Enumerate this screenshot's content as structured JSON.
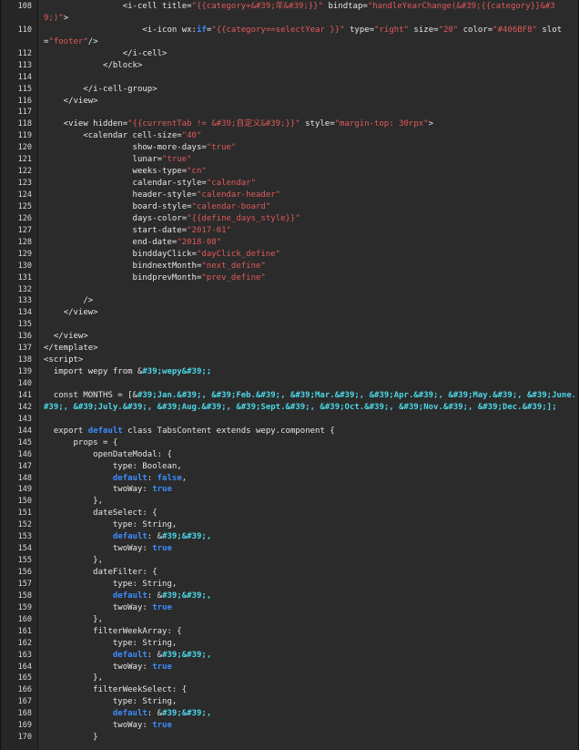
{
  "editor": {
    "colors": {
      "background": "#2b2b2b",
      "plain": "#e6e6e6",
      "string": "#e05a5a",
      "entity": "#4cd6e6",
      "keyword": "#3b8cff"
    },
    "lines": [
      {
        "num": "108",
        "tokens": [
          {
            "t": "p",
            "v": "                <i-cell title="
          },
          {
            "t": "s",
            "v": "\"{{category+&#39;年&#39;}}\""
          },
          {
            "t": "p",
            "v": " bindtap="
          },
          {
            "t": "s",
            "v": "\"handleYearChange(&#39;{{category}}&#3"
          }
        ]
      },
      {
        "num": "",
        "tokens": [
          {
            "t": "s",
            "v": "9;)\""
          },
          {
            "t": "p",
            "v": ">"
          }
        ]
      },
      {
        "num": "110",
        "tokens": [
          {
            "t": "p",
            "v": "                    <i-icon wx:"
          },
          {
            "t": "k",
            "v": "if"
          },
          {
            "t": "p",
            "v": "="
          },
          {
            "t": "s",
            "v": "\"{{category==selectYear }}\""
          },
          {
            "t": "p",
            "v": " type="
          },
          {
            "t": "s",
            "v": "\"right\""
          },
          {
            "t": "p",
            "v": " size="
          },
          {
            "t": "s",
            "v": "\"20\""
          },
          {
            "t": "p",
            "v": " color="
          },
          {
            "t": "s",
            "v": "\"#406BF8\""
          },
          {
            "t": "p",
            "v": " slot"
          }
        ]
      },
      {
        "num": "",
        "tokens": [
          {
            "t": "p",
            "v": "="
          },
          {
            "t": "s",
            "v": "\"footer\""
          },
          {
            "t": "p",
            "v": "/>"
          }
        ]
      },
      {
        "num": "112",
        "tokens": [
          {
            "t": "p",
            "v": "                </i-cell>"
          }
        ]
      },
      {
        "num": "113",
        "tokens": [
          {
            "t": "p",
            "v": "            </block>"
          }
        ]
      },
      {
        "num": "114",
        "tokens": [
          {
            "t": "p",
            "v": ""
          }
        ]
      },
      {
        "num": "115",
        "tokens": [
          {
            "t": "p",
            "v": "        </i-cell-group>"
          }
        ]
      },
      {
        "num": "116",
        "tokens": [
          {
            "t": "p",
            "v": "    </view>"
          }
        ]
      },
      {
        "num": "117",
        "tokens": [
          {
            "t": "p",
            "v": ""
          }
        ]
      },
      {
        "num": "118",
        "tokens": [
          {
            "t": "p",
            "v": "    <view hidden="
          },
          {
            "t": "s",
            "v": "\"{{currentTab != &#39;自定义&#39;}}\""
          },
          {
            "t": "p",
            "v": " style="
          },
          {
            "t": "s",
            "v": "\"margin-top: 30rpx\""
          },
          {
            "t": "p",
            "v": ">"
          }
        ]
      },
      {
        "num": "119",
        "tokens": [
          {
            "t": "p",
            "v": "        <calendar cell-size="
          },
          {
            "t": "s",
            "v": "\"40\""
          }
        ]
      },
      {
        "num": "120",
        "tokens": [
          {
            "t": "p",
            "v": "                  show-more-days="
          },
          {
            "t": "s",
            "v": "\"true\""
          }
        ]
      },
      {
        "num": "121",
        "tokens": [
          {
            "t": "p",
            "v": "                  lunar="
          },
          {
            "t": "s",
            "v": "\"true\""
          }
        ]
      },
      {
        "num": "122",
        "tokens": [
          {
            "t": "p",
            "v": "                  weeks-type="
          },
          {
            "t": "s",
            "v": "\"cn\""
          }
        ]
      },
      {
        "num": "123",
        "tokens": [
          {
            "t": "p",
            "v": "                  calendar-style="
          },
          {
            "t": "s",
            "v": "\"calendar\""
          }
        ]
      },
      {
        "num": "124",
        "tokens": [
          {
            "t": "p",
            "v": "                  header-style="
          },
          {
            "t": "s",
            "v": "\"calendar-header\""
          }
        ]
      },
      {
        "num": "125",
        "tokens": [
          {
            "t": "p",
            "v": "                  board-style="
          },
          {
            "t": "s",
            "v": "\"calendar-board\""
          }
        ]
      },
      {
        "num": "126",
        "tokens": [
          {
            "t": "p",
            "v": "                  days-color="
          },
          {
            "t": "s",
            "v": "\"{{define_days_style}}\""
          }
        ]
      },
      {
        "num": "127",
        "tokens": [
          {
            "t": "p",
            "v": "                  start-date="
          },
          {
            "t": "s",
            "v": "\"2017-01\""
          }
        ]
      },
      {
        "num": "128",
        "tokens": [
          {
            "t": "p",
            "v": "                  end-date="
          },
          {
            "t": "s",
            "v": "\"2018-08\""
          }
        ]
      },
      {
        "num": "129",
        "tokens": [
          {
            "t": "p",
            "v": "                  binddayClick="
          },
          {
            "t": "s",
            "v": "\"dayClick_define\""
          }
        ]
      },
      {
        "num": "130",
        "tokens": [
          {
            "t": "p",
            "v": "                  bindnextMonth="
          },
          {
            "t": "s",
            "v": "\"next_define\""
          }
        ]
      },
      {
        "num": "131",
        "tokens": [
          {
            "t": "p",
            "v": "                  bindprevMonth="
          },
          {
            "t": "s",
            "v": "\"prev_define\""
          }
        ]
      },
      {
        "num": "132",
        "tokens": [
          {
            "t": "p",
            "v": ""
          }
        ]
      },
      {
        "num": "133",
        "tokens": [
          {
            "t": "p",
            "v": "        />"
          }
        ]
      },
      {
        "num": "134",
        "tokens": [
          {
            "t": "p",
            "v": "    </view>"
          }
        ]
      },
      {
        "num": "135",
        "tokens": [
          {
            "t": "p",
            "v": ""
          }
        ]
      },
      {
        "num": "136",
        "tokens": [
          {
            "t": "p",
            "v": "  </view>"
          }
        ]
      },
      {
        "num": "137",
        "tokens": [
          {
            "t": "p",
            "v": "</template>"
          }
        ]
      },
      {
        "num": "138",
        "tokens": [
          {
            "t": "p",
            "v": "<script>"
          }
        ]
      },
      {
        "num": "139",
        "tokens": [
          {
            "t": "p",
            "v": "  import wepy from &"
          },
          {
            "t": "e",
            "v": "#39;wepy&#39;;"
          }
        ]
      },
      {
        "num": "140",
        "tokens": [
          {
            "t": "p",
            "v": ""
          }
        ]
      },
      {
        "num": "141",
        "tokens": [
          {
            "t": "p",
            "v": "  const MONTHS = [&"
          },
          {
            "t": "e",
            "v": "#39;Jan.&#39;, &#39;Feb.&#39;, &#39;Mar.&#39;, &#39;Apr.&#39;, &#39;May.&#39;, &#39;June.&"
          }
        ]
      },
      {
        "num": "142",
        "tokens": [
          {
            "t": "e",
            "v": "#39;, &#39;July.&#39;, &#39;Aug.&#39;, &#39;Sept.&#39;, &#39;Oct.&#39;, &#39;Nov.&#39;, &#39;Dec.&#39;];"
          }
        ]
      },
      {
        "num": "143",
        "tokens": [
          {
            "t": "p",
            "v": ""
          }
        ]
      },
      {
        "num": "144",
        "tokens": [
          {
            "t": "p",
            "v": "  export "
          },
          {
            "t": "k",
            "v": "default"
          },
          {
            "t": "p",
            "v": " class TabsContent extends wepy.component {"
          }
        ]
      },
      {
        "num": "145",
        "tokens": [
          {
            "t": "p",
            "v": "      props = {"
          }
        ]
      },
      {
        "num": "146",
        "tokens": [
          {
            "t": "p",
            "v": "          openDateModal: {"
          }
        ]
      },
      {
        "num": "147",
        "tokens": [
          {
            "t": "p",
            "v": "              type: Boolean,"
          }
        ]
      },
      {
        "num": "148",
        "tokens": [
          {
            "t": "p",
            "v": "              "
          },
          {
            "t": "k",
            "v": "default"
          },
          {
            "t": "p",
            "v": ": "
          },
          {
            "t": "k",
            "v": "false"
          },
          {
            "t": "p",
            "v": ","
          }
        ]
      },
      {
        "num": "149",
        "tokens": [
          {
            "t": "p",
            "v": "              twoWay: "
          },
          {
            "t": "k",
            "v": "true"
          }
        ]
      },
      {
        "num": "150",
        "tokens": [
          {
            "t": "p",
            "v": "          },"
          }
        ]
      },
      {
        "num": "151",
        "tokens": [
          {
            "t": "p",
            "v": "          dateSelect: {"
          }
        ]
      },
      {
        "num": "152",
        "tokens": [
          {
            "t": "p",
            "v": "              type: String,"
          }
        ]
      },
      {
        "num": "153",
        "tokens": [
          {
            "t": "p",
            "v": "              "
          },
          {
            "t": "k",
            "v": "default"
          },
          {
            "t": "p",
            "v": ": &"
          },
          {
            "t": "e",
            "v": "#39;&#39;,"
          }
        ]
      },
      {
        "num": "154",
        "tokens": [
          {
            "t": "p",
            "v": "              twoWay: "
          },
          {
            "t": "k",
            "v": "true"
          }
        ]
      },
      {
        "num": "155",
        "tokens": [
          {
            "t": "p",
            "v": "          },"
          }
        ]
      },
      {
        "num": "156",
        "tokens": [
          {
            "t": "p",
            "v": "          dateFilter: {"
          }
        ]
      },
      {
        "num": "157",
        "tokens": [
          {
            "t": "p",
            "v": "              type: String,"
          }
        ]
      },
      {
        "num": "158",
        "tokens": [
          {
            "t": "p",
            "v": "              "
          },
          {
            "t": "k",
            "v": "default"
          },
          {
            "t": "p",
            "v": ": &"
          },
          {
            "t": "e",
            "v": "#39;&#39;,"
          }
        ]
      },
      {
        "num": "159",
        "tokens": [
          {
            "t": "p",
            "v": "              twoWay: "
          },
          {
            "t": "k",
            "v": "true"
          }
        ]
      },
      {
        "num": "160",
        "tokens": [
          {
            "t": "p",
            "v": "          },"
          }
        ]
      },
      {
        "num": "161",
        "tokens": [
          {
            "t": "p",
            "v": "          filterWeekArray: {"
          }
        ]
      },
      {
        "num": "162",
        "tokens": [
          {
            "t": "p",
            "v": "              type: String,"
          }
        ]
      },
      {
        "num": "163",
        "tokens": [
          {
            "t": "p",
            "v": "              "
          },
          {
            "t": "k",
            "v": "default"
          },
          {
            "t": "p",
            "v": ": &"
          },
          {
            "t": "e",
            "v": "#39;&#39;,"
          }
        ]
      },
      {
        "num": "164",
        "tokens": [
          {
            "t": "p",
            "v": "              twoWay: "
          },
          {
            "t": "k",
            "v": "true"
          }
        ]
      },
      {
        "num": "165",
        "tokens": [
          {
            "t": "p",
            "v": "          },"
          }
        ]
      },
      {
        "num": "166",
        "tokens": [
          {
            "t": "p",
            "v": "          filterWeekSelect: {"
          }
        ]
      },
      {
        "num": "167",
        "tokens": [
          {
            "t": "p",
            "v": "              type: String,"
          }
        ]
      },
      {
        "num": "168",
        "tokens": [
          {
            "t": "p",
            "v": "              "
          },
          {
            "t": "k",
            "v": "default"
          },
          {
            "t": "p",
            "v": ": &"
          },
          {
            "t": "e",
            "v": "#39;&#39;,"
          }
        ]
      },
      {
        "num": "169",
        "tokens": [
          {
            "t": "p",
            "v": "              twoWay: "
          },
          {
            "t": "k",
            "v": "true"
          }
        ]
      },
      {
        "num": "170",
        "tokens": [
          {
            "t": "p",
            "v": "          }"
          }
        ]
      }
    ]
  }
}
